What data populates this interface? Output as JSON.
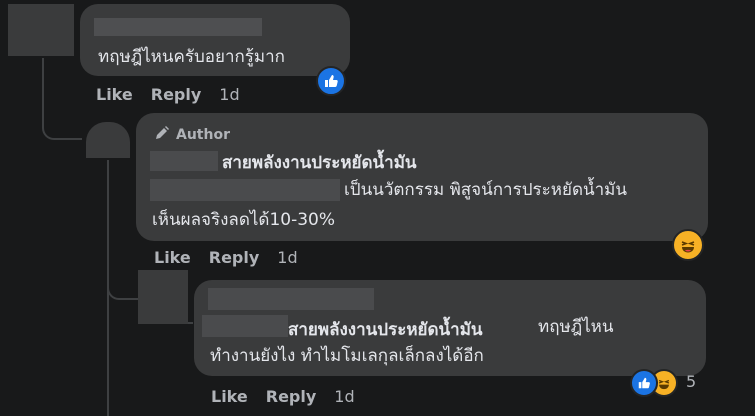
{
  "comment1": {
    "text": "ทฤษฎีไหนครับอยากรู้มาก",
    "like_label": "Like",
    "reply_label": "Reply",
    "time": "1d",
    "reaction_icon": "like-icon"
  },
  "comment2": {
    "author_badge": "Author",
    "author_badge_icon": "pencil-icon",
    "name": "สายพลังงานประหยัดน้ำมัน",
    "text_line1": "เป็นนวัตกรรม พิสูจน์การประหยัดน้ำมัน",
    "text_line2": "เห็นผลจริงลดได้10-30%",
    "like_label": "Like",
    "reply_label": "Reply",
    "time": "1d",
    "reaction_icon": "haha-icon"
  },
  "comment3": {
    "mention": "สายพลังงานประหยัดน้ำมัน",
    "text_line1": "ทฤษฎีไหน",
    "text_line2": "ทำงานยังไง ทำไมโมเลกุลเล็กลงได้อีก",
    "like_label": "Like",
    "reply_label": "Reply",
    "time": "1d",
    "reaction_count": "5",
    "reaction_icons": [
      "like-icon",
      "haha-icon"
    ]
  }
}
